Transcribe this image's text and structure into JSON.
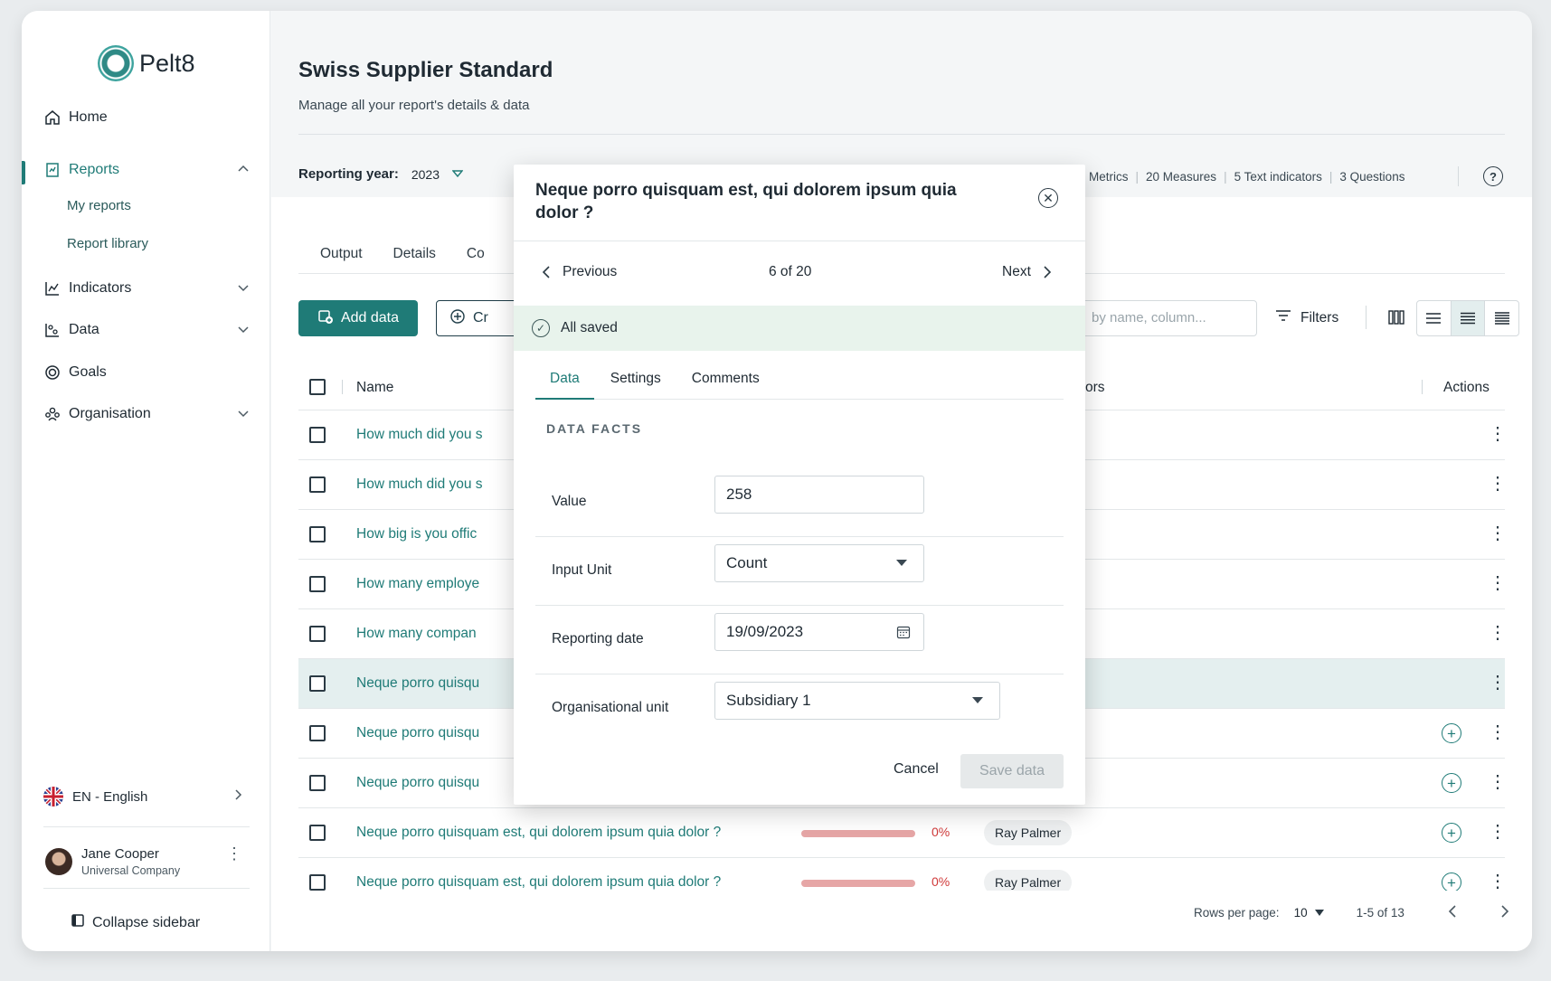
{
  "app": {
    "logo_text": "Pelt8"
  },
  "sidebar": {
    "home": "Home",
    "reports": "Reports",
    "my_reports": "My reports",
    "report_library": "Report library",
    "indicators": "Indicators",
    "data": "Data",
    "goals": "Goals",
    "organisation": "Organisation",
    "language": "EN - English",
    "user_name": "Jane Cooper",
    "user_company": "Universal Company",
    "collapse": "Collapse sidebar"
  },
  "header": {
    "title": "Swiss Supplier Standard",
    "subtitle": "Manage all your report's details & data",
    "year_label": "Reporting year:",
    "year_value": "2023",
    "counts": [
      "Metrics",
      "20 Measures",
      "5 Text indicators",
      "3 Questions"
    ],
    "help": "?"
  },
  "tabs": [
    "Output",
    "Details",
    "Co"
  ],
  "toolbar": {
    "add_data": "Add data",
    "create": "Cr",
    "search_placeholder": "by name, column...",
    "filters": "Filters"
  },
  "table": {
    "col_name": "Name",
    "col_ors": "ors",
    "col_actions": "Actions",
    "rows": [
      {
        "name": "How much did you s",
        "highlight": false,
        "plus": false
      },
      {
        "name": "How much did you s",
        "highlight": false,
        "plus": false
      },
      {
        "name": "How big is you offic",
        "highlight": false,
        "plus": false
      },
      {
        "name": "How many employe",
        "highlight": false,
        "plus": false
      },
      {
        "name": "How many compan",
        "highlight": false,
        "plus": false
      },
      {
        "name": "Neque porro quisqu",
        "highlight": true,
        "plus": false
      },
      {
        "name": "Neque porro quisqu",
        "highlight": false,
        "plus": true
      },
      {
        "name": "Neque porro quisqu",
        "highlight": false,
        "plus": true
      },
      {
        "name": "Neque porro quisquam est, qui dolorem ipsum quia dolor ?",
        "highlight": false,
        "plus": true,
        "progress": "0%",
        "assignee": "Ray Palmer"
      },
      {
        "name": "Neque porro quisquam est, qui dolorem ipsum quia dolor ?",
        "highlight": false,
        "plus": true,
        "progress": "0%",
        "assignee": "Ray Palmer"
      }
    ]
  },
  "pagination": {
    "rows_label": "Rows per page:",
    "rows_value": "10",
    "range": "1-5 of 13"
  },
  "modal": {
    "title": "Neque porro quisquam est, qui dolorem ipsum quia dolor ?",
    "previous": "Previous",
    "position": "6 of 20",
    "next": "Next",
    "saved": "All saved",
    "tabs": [
      "Data",
      "Settings",
      "Comments"
    ],
    "section": "DATA FACTS",
    "fields": {
      "value_label": "Value",
      "value": "258",
      "unit_label": "Input Unit",
      "unit": "Count",
      "date_label": "Reporting date",
      "date": "19/09/2023",
      "org_label": "Organisational unit",
      "org": "Subsidiary 1"
    },
    "cancel": "Cancel",
    "save": "Save data"
  },
  "colors": {
    "accent": "#1f7b77",
    "highlight_row": "#e4efef",
    "saved_bg": "#e8f3ec",
    "progress": "#e6a6a6",
    "danger": "#d03a3a"
  }
}
